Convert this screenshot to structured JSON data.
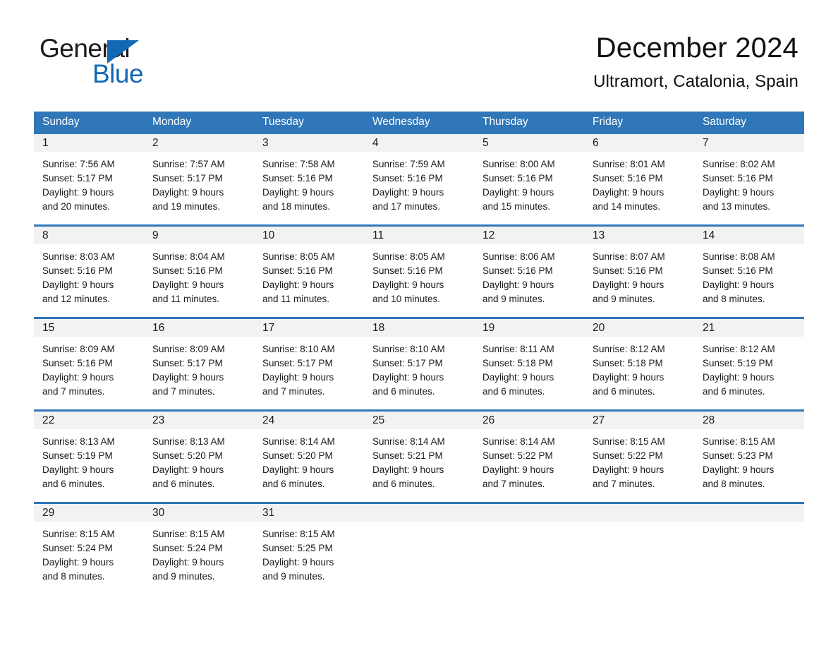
{
  "brand": {
    "name_part1": "General",
    "name_part2": "Blue",
    "logo_icon": "triangle-play-icon",
    "accent_color": "#1268b3"
  },
  "header": {
    "title": "December 2024",
    "location": "Ultramort, Catalonia, Spain"
  },
  "theme": {
    "header_blue": "#2f77b8",
    "day_band_gray": "#f2f2f2",
    "text_color": "#1a1a1a",
    "page_background": "#ffffff"
  },
  "weekdays": [
    "Sunday",
    "Monday",
    "Tuesday",
    "Wednesday",
    "Thursday",
    "Friday",
    "Saturday"
  ],
  "weeks": [
    {
      "days": [
        {
          "num": "1",
          "sunrise": "Sunrise: 7:56 AM",
          "sunset": "Sunset: 5:17 PM",
          "daylight1": "Daylight: 9 hours",
          "daylight2": "and 20 minutes."
        },
        {
          "num": "2",
          "sunrise": "Sunrise: 7:57 AM",
          "sunset": "Sunset: 5:17 PM",
          "daylight1": "Daylight: 9 hours",
          "daylight2": "and 19 minutes."
        },
        {
          "num": "3",
          "sunrise": "Sunrise: 7:58 AM",
          "sunset": "Sunset: 5:16 PM",
          "daylight1": "Daylight: 9 hours",
          "daylight2": "and 18 minutes."
        },
        {
          "num": "4",
          "sunrise": "Sunrise: 7:59 AM",
          "sunset": "Sunset: 5:16 PM",
          "daylight1": "Daylight: 9 hours",
          "daylight2": "and 17 minutes."
        },
        {
          "num": "5",
          "sunrise": "Sunrise: 8:00 AM",
          "sunset": "Sunset: 5:16 PM",
          "daylight1": "Daylight: 9 hours",
          "daylight2": "and 15 minutes."
        },
        {
          "num": "6",
          "sunrise": "Sunrise: 8:01 AM",
          "sunset": "Sunset: 5:16 PM",
          "daylight1": "Daylight: 9 hours",
          "daylight2": "and 14 minutes."
        },
        {
          "num": "7",
          "sunrise": "Sunrise: 8:02 AM",
          "sunset": "Sunset: 5:16 PM",
          "daylight1": "Daylight: 9 hours",
          "daylight2": "and 13 minutes."
        }
      ]
    },
    {
      "days": [
        {
          "num": "8",
          "sunrise": "Sunrise: 8:03 AM",
          "sunset": "Sunset: 5:16 PM",
          "daylight1": "Daylight: 9 hours",
          "daylight2": "and 12 minutes."
        },
        {
          "num": "9",
          "sunrise": "Sunrise: 8:04 AM",
          "sunset": "Sunset: 5:16 PM",
          "daylight1": "Daylight: 9 hours",
          "daylight2": "and 11 minutes."
        },
        {
          "num": "10",
          "sunrise": "Sunrise: 8:05 AM",
          "sunset": "Sunset: 5:16 PM",
          "daylight1": "Daylight: 9 hours",
          "daylight2": "and 11 minutes."
        },
        {
          "num": "11",
          "sunrise": "Sunrise: 8:05 AM",
          "sunset": "Sunset: 5:16 PM",
          "daylight1": "Daylight: 9 hours",
          "daylight2": "and 10 minutes."
        },
        {
          "num": "12",
          "sunrise": "Sunrise: 8:06 AM",
          "sunset": "Sunset: 5:16 PM",
          "daylight1": "Daylight: 9 hours",
          "daylight2": "and 9 minutes."
        },
        {
          "num": "13",
          "sunrise": "Sunrise: 8:07 AM",
          "sunset": "Sunset: 5:16 PM",
          "daylight1": "Daylight: 9 hours",
          "daylight2": "and 9 minutes."
        },
        {
          "num": "14",
          "sunrise": "Sunrise: 8:08 AM",
          "sunset": "Sunset: 5:16 PM",
          "daylight1": "Daylight: 9 hours",
          "daylight2": "and 8 minutes."
        }
      ]
    },
    {
      "days": [
        {
          "num": "15",
          "sunrise": "Sunrise: 8:09 AM",
          "sunset": "Sunset: 5:16 PM",
          "daylight1": "Daylight: 9 hours",
          "daylight2": "and 7 minutes."
        },
        {
          "num": "16",
          "sunrise": "Sunrise: 8:09 AM",
          "sunset": "Sunset: 5:17 PM",
          "daylight1": "Daylight: 9 hours",
          "daylight2": "and 7 minutes."
        },
        {
          "num": "17",
          "sunrise": "Sunrise: 8:10 AM",
          "sunset": "Sunset: 5:17 PM",
          "daylight1": "Daylight: 9 hours",
          "daylight2": "and 7 minutes."
        },
        {
          "num": "18",
          "sunrise": "Sunrise: 8:10 AM",
          "sunset": "Sunset: 5:17 PM",
          "daylight1": "Daylight: 9 hours",
          "daylight2": "and 6 minutes."
        },
        {
          "num": "19",
          "sunrise": "Sunrise: 8:11 AM",
          "sunset": "Sunset: 5:18 PM",
          "daylight1": "Daylight: 9 hours",
          "daylight2": "and 6 minutes."
        },
        {
          "num": "20",
          "sunrise": "Sunrise: 8:12 AM",
          "sunset": "Sunset: 5:18 PM",
          "daylight1": "Daylight: 9 hours",
          "daylight2": "and 6 minutes."
        },
        {
          "num": "21",
          "sunrise": "Sunrise: 8:12 AM",
          "sunset": "Sunset: 5:19 PM",
          "daylight1": "Daylight: 9 hours",
          "daylight2": "and 6 minutes."
        }
      ]
    },
    {
      "days": [
        {
          "num": "22",
          "sunrise": "Sunrise: 8:13 AM",
          "sunset": "Sunset: 5:19 PM",
          "daylight1": "Daylight: 9 hours",
          "daylight2": "and 6 minutes."
        },
        {
          "num": "23",
          "sunrise": "Sunrise: 8:13 AM",
          "sunset": "Sunset: 5:20 PM",
          "daylight1": "Daylight: 9 hours",
          "daylight2": "and 6 minutes."
        },
        {
          "num": "24",
          "sunrise": "Sunrise: 8:14 AM",
          "sunset": "Sunset: 5:20 PM",
          "daylight1": "Daylight: 9 hours",
          "daylight2": "and 6 minutes."
        },
        {
          "num": "25",
          "sunrise": "Sunrise: 8:14 AM",
          "sunset": "Sunset: 5:21 PM",
          "daylight1": "Daylight: 9 hours",
          "daylight2": "and 6 minutes."
        },
        {
          "num": "26",
          "sunrise": "Sunrise: 8:14 AM",
          "sunset": "Sunset: 5:22 PM",
          "daylight1": "Daylight: 9 hours",
          "daylight2": "and 7 minutes."
        },
        {
          "num": "27",
          "sunrise": "Sunrise: 8:15 AM",
          "sunset": "Sunset: 5:22 PM",
          "daylight1": "Daylight: 9 hours",
          "daylight2": "and 7 minutes."
        },
        {
          "num": "28",
          "sunrise": "Sunrise: 8:15 AM",
          "sunset": "Sunset: 5:23 PM",
          "daylight1": "Daylight: 9 hours",
          "daylight2": "and 8 minutes."
        }
      ]
    },
    {
      "days": [
        {
          "num": "29",
          "sunrise": "Sunrise: 8:15 AM",
          "sunset": "Sunset: 5:24 PM",
          "daylight1": "Daylight: 9 hours",
          "daylight2": "and 8 minutes."
        },
        {
          "num": "30",
          "sunrise": "Sunrise: 8:15 AM",
          "sunset": "Sunset: 5:24 PM",
          "daylight1": "Daylight: 9 hours",
          "daylight2": "and 9 minutes."
        },
        {
          "num": "31",
          "sunrise": "Sunrise: 8:15 AM",
          "sunset": "Sunset: 5:25 PM",
          "daylight1": "Daylight: 9 hours",
          "daylight2": "and 9 minutes."
        },
        {
          "num": "",
          "sunrise": "",
          "sunset": "",
          "daylight1": "",
          "daylight2": ""
        },
        {
          "num": "",
          "sunrise": "",
          "sunset": "",
          "daylight1": "",
          "daylight2": ""
        },
        {
          "num": "",
          "sunrise": "",
          "sunset": "",
          "daylight1": "",
          "daylight2": ""
        },
        {
          "num": "",
          "sunrise": "",
          "sunset": "",
          "daylight1": "",
          "daylight2": ""
        }
      ]
    }
  ]
}
